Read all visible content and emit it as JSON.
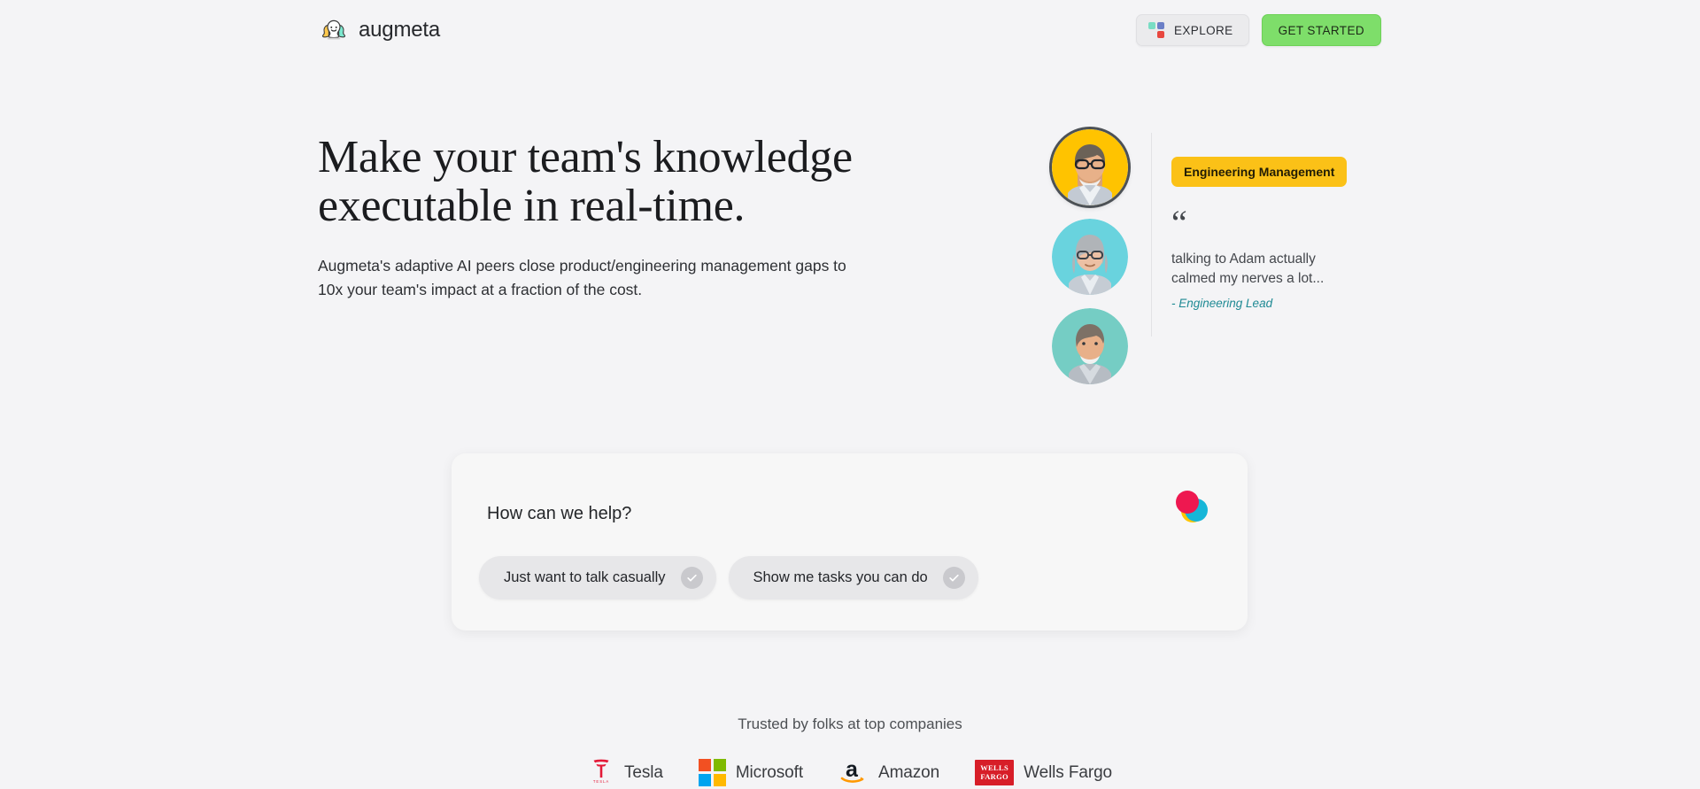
{
  "brand": {
    "name": "augmeta",
    "logo_icon": "people-trio-icon"
  },
  "header": {
    "explore_label": "EXPLORE",
    "explore_icon": "grid-4-squares-icon",
    "get_started_label": "GET STARTED",
    "grid_colors": [
      "#79ddc4",
      "#6b7fc7",
      "#f5b royalty",
      "#e8473f"
    ]
  },
  "hero": {
    "title": "Make your team's knowledge executable in real-time.",
    "subtitle": "Augmeta's adaptive AI peers close product/engineering management gaps to 10x your team's impact at a fraction of the cost."
  },
  "avatars": [
    {
      "name": "avatar-engineering-management",
      "bg": "#ffc300",
      "active": true
    },
    {
      "name": "avatar-second-persona",
      "bg": "#69d3de",
      "active": false
    },
    {
      "name": "avatar-third-persona",
      "bg": "#75cdc4",
      "active": false
    }
  ],
  "testimonial": {
    "badge": "Engineering Management",
    "badge_color": "#fbc117",
    "quote_icon": "quote-mark-icon",
    "quote": "talking to Adam actually calmed my nerves a lot...",
    "author": "- Engineering Lead",
    "author_color": "#1f8a94"
  },
  "help_card": {
    "title": "How can we help?",
    "decoration_icon": "three-circles-icon",
    "decoration_colors": [
      "#ee1850",
      "#16b6d8",
      "#ffc600"
    ],
    "options": [
      {
        "label": "Just want to talk casually",
        "icon": "check-circle-icon"
      },
      {
        "label": "Show me tasks you can do",
        "icon": "check-circle-icon"
      }
    ]
  },
  "trusted": {
    "label": "Trusted by folks at top companies",
    "companies": [
      {
        "name": "Tesla",
        "icon": "tesla-logo-icon",
        "color": "#e31937"
      },
      {
        "name": "Microsoft",
        "icon": "microsoft-logo-icon"
      },
      {
        "name": "Amazon",
        "icon": "amazon-logo-icon",
        "color": "#131a22"
      },
      {
        "name": "Wells Fargo",
        "icon": "wells-fargo-logo-icon",
        "color": "#d71e28",
        "mark_line1": "WELLS",
        "mark_line2": "FARGO"
      }
    ]
  }
}
